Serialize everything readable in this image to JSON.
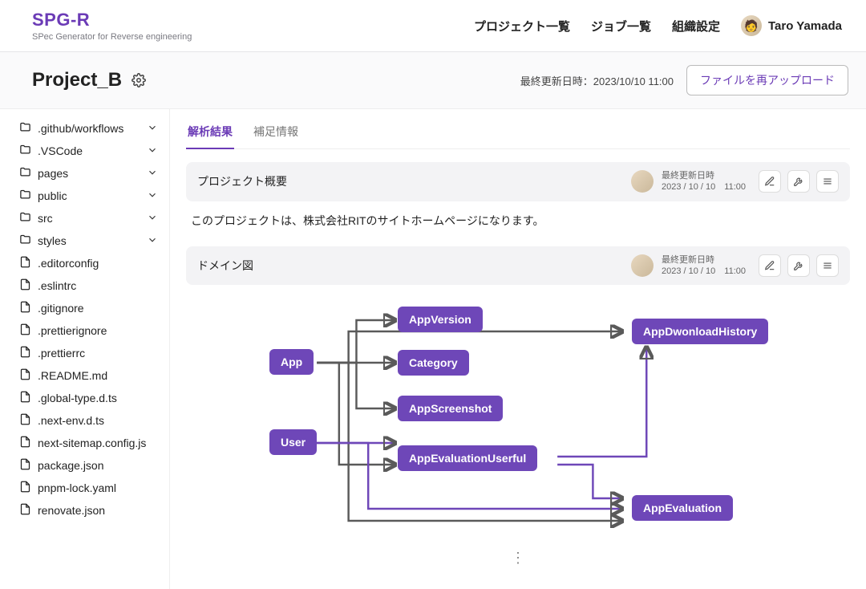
{
  "brand": {
    "name": "SPG-R",
    "tagline": "SPec Generator for Reverse engineering"
  },
  "nav": {
    "projects": "プロジェクト一覧",
    "jobs": "ジョブ一覧",
    "org": "組織設定",
    "user": "Taro Yamada"
  },
  "page": {
    "title": "Project_B",
    "lastmod": "最終更新日時：2023/10/10 11:00",
    "reupload": "ファイルを再アップロード"
  },
  "sidebar": {
    "folders": [
      {
        "label": ".github/workflows"
      },
      {
        "label": ".VSCode"
      },
      {
        "label": "pages"
      },
      {
        "label": "public"
      },
      {
        "label": "src"
      },
      {
        "label": "styles"
      }
    ],
    "files": [
      {
        "label": ".editorconfig"
      },
      {
        "label": ".eslintrc"
      },
      {
        "label": ".gitignore"
      },
      {
        "label": ".prettierignore"
      },
      {
        "label": ".prettierrc"
      },
      {
        "label": ".README.md"
      },
      {
        "label": ".global-type.d.ts"
      },
      {
        "label": ".next-env.d.ts"
      },
      {
        "label": "next-sitemap.config.js"
      },
      {
        "label": "package.json"
      },
      {
        "label": "pnpm-lock.yaml"
      },
      {
        "label": "renovate.json"
      }
    ]
  },
  "tabs": {
    "results": "解析結果",
    "supplement": "補足情報"
  },
  "cards": {
    "meta_label": "最終更新日時",
    "meta_date": "2023 / 10 / 10　11:00",
    "overview": {
      "title": "プロジェクト概要",
      "body": "このプロジェクトは、株式会社RITのサイトホームページになります。"
    },
    "domain": {
      "title": "ドメイン図"
    }
  },
  "diagram": {
    "nodes": {
      "app": "App",
      "user": "User",
      "appversion": "AppVersion",
      "category": "Category",
      "appscreenshot": "AppScreenshot",
      "appevaluationuserful": "AppEvaluationUserful",
      "appdownloadhistory": "AppDwonloadHistory",
      "appevaluation": "AppEvaluation"
    }
  },
  "more": "⋮"
}
